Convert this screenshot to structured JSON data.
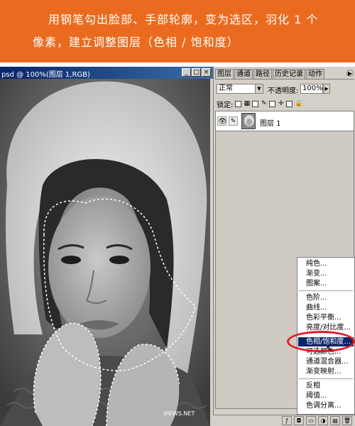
{
  "banner": {
    "line1": "用钢笔勾出脸部、手部轮廓，变为选区，羽化 1 个",
    "line2": "像素，建立调整图层（色相 / 饱和度）",
    "bg_color": "#ea6b1f"
  },
  "document": {
    "title": "psd @ 100%(图层 1,RGB)",
    "window_buttons": [
      "_",
      "□",
      "×"
    ],
    "watermark": "VIEWS.NET"
  },
  "palette": {
    "tabs": [
      "图层",
      "通道",
      "路径",
      "历史记录",
      "动作"
    ],
    "blend_mode": "正常",
    "opacity_label": "不透明度:",
    "opacity_value": "100%",
    "lock_label": "锁定:",
    "layer": {
      "name": "图层 1"
    }
  },
  "context_menu": {
    "group1": [
      "纯色...",
      "渐变...",
      "图案..."
    ],
    "group2": [
      "色阶...",
      "曲线...",
      "色彩平衡...",
      "亮度/对比度..."
    ],
    "highlighted": "色相/饱和度...",
    "group3": [
      "可选颜色...",
      "通道混合器...",
      "渐变映射..."
    ],
    "group4": [
      "反相",
      "阈值...",
      "色调分离..."
    ]
  },
  "icons": {
    "eye": "eye-icon",
    "brush": "brush-icon",
    "accent_circle_color": "#e8182a",
    "highlight_color": "#0a246a"
  }
}
